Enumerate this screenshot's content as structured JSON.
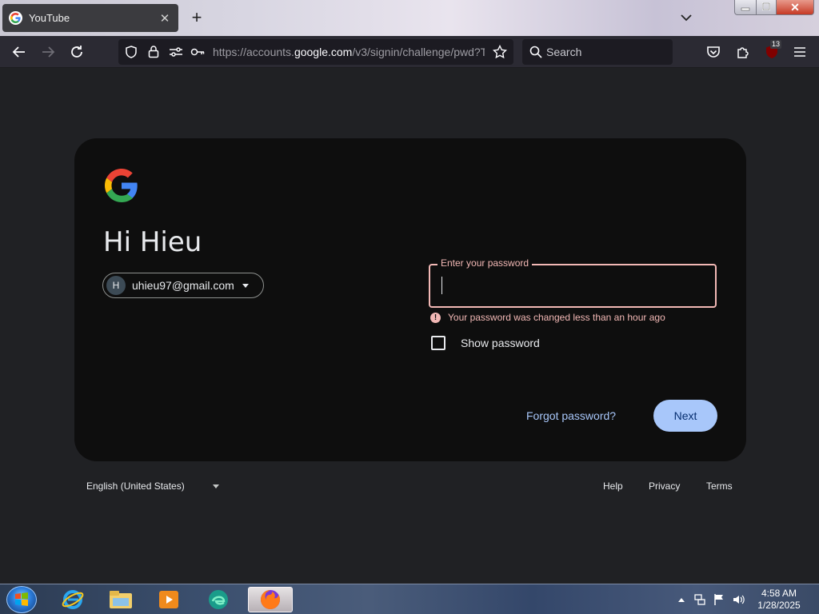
{
  "browser": {
    "tab": {
      "title": "YouTube",
      "close_glyph": "✕"
    },
    "new_tab_glyph": "+",
    "address_bar": {
      "url_prefix": "https://accounts.",
      "url_host": "google.com",
      "url_path": "/v3/signin/challenge/pwd?T"
    },
    "search": {
      "placeholder": "Search"
    },
    "extension_badge": "13",
    "window_close_glyph": "✕"
  },
  "signin": {
    "avatar_initial": "H",
    "greeting": "Hi Hieu",
    "account_email": "uhieu97@gmail.com",
    "password_label": "Enter your password",
    "password_value": "",
    "error_icon": "!",
    "error_message": "Your password was changed less than an hour ago",
    "show_password_label": "Show password",
    "show_password_checked": false,
    "forgot_link": "Forgot password?",
    "next_button": "Next"
  },
  "footer": {
    "language": "English (United States)",
    "links": [
      "Help",
      "Privacy",
      "Terms"
    ]
  },
  "taskbar": {
    "pinned": [
      "start-orb",
      "internet-explorer-icon",
      "file-explorer-icon",
      "media-player-icon",
      "edge-icon",
      "firefox-icon"
    ],
    "tray": [
      "show-hidden-icon",
      "network-icon",
      "action-center-flag-icon",
      "volume-icon"
    ],
    "time": "4:58 AM",
    "date": "1/28/2025"
  },
  "colors": {
    "card_bg": "#0e0e0e",
    "page_bg": "#202124",
    "error": "#f2b8b5",
    "link": "#a8c7fa",
    "primary_button": "#a8c7fa"
  }
}
